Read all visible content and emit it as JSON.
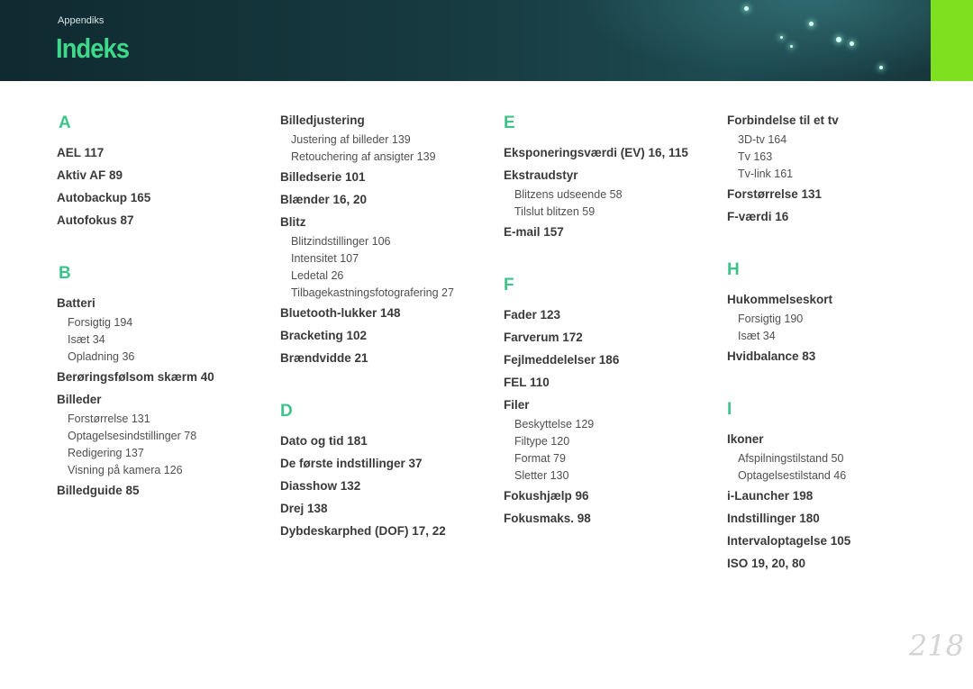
{
  "header": {
    "section": "Appendiks",
    "title": "Indeks"
  },
  "columns": [
    {
      "letter1": "A",
      "a": [
        "AEL  117",
        "Aktiv AF  89",
        "Autobackup  165",
        "Autofokus  87"
      ],
      "letter2": "B",
      "batteri": "Batteri",
      "batteri_sub": [
        "Forsigtig  194",
        "Isæt  34",
        "Opladning  36"
      ],
      "beroring": "Berøringsfølsom skærm  40",
      "billeder": "Billeder",
      "billeder_sub": [
        "Forstørrelse  131",
        "Optagelsesindstillinger  78",
        "Redigering  137",
        "Visning på kamera  126"
      ],
      "billedguide": "Billedguide  85"
    },
    {
      "billedjustering": "Billedjustering",
      "billedjustering_sub": [
        "Justering af billeder  139",
        "Retouchering af ansigter  139"
      ],
      "billedserie": "Billedserie  101",
      "blaender": "Blænder  16, 20",
      "blitz": "Blitz",
      "blitz_sub": [
        "Blitzindstillinger  106",
        "Intensitet  107",
        "Ledetal  26",
        "Tilbagekastningsfotografering  27"
      ],
      "more_b": [
        "Bluetooth-lukker  148",
        "Bracketing  102",
        "Brændvidde  21"
      ],
      "letter": "D",
      "d": [
        "Dato og tid  181",
        "De første indstillinger  37",
        "Diasshow  132",
        "Drej  138",
        "Dybdeskarphed (DOF)  17, 22"
      ]
    },
    {
      "letter1": "E",
      "eksponering": "Eksponeringsværdi (EV)  16, 115",
      "ekstraudstyr": "Ekstraudstyr",
      "ekstraudstyr_sub": [
        "Blitzens udseende  58",
        "Tilslut blitzen  59"
      ],
      "email": "E-mail  157",
      "letter2": "F",
      "f": [
        "Fader  123",
        "Farverum  172",
        "Fejlmeddelelser  186",
        "FEL  110"
      ],
      "filer": "Filer",
      "filer_sub": [
        "Beskyttelse  129",
        "Filtype  120",
        "Format  79",
        "Sletter  130"
      ],
      "f2": [
        "Fokushjælp  96",
        "Fokusmaks.  98"
      ]
    },
    {
      "forbindelse": "Forbindelse til et tv",
      "forbindelse_sub": [
        "3D-tv  164",
        "Tv  163",
        "Tv-link  161"
      ],
      "forstorrelse": "Forstørrelse  131",
      "fvaerdi": "F-værdi  16",
      "letter_h": "H",
      "hukommelseskort": "Hukommelseskort",
      "hukommelseskort_sub": [
        "Forsigtig  190",
        "Isæt  34"
      ],
      "hvidbalance": "Hvidbalance  83",
      "letter_i": "I",
      "ikoner": "Ikoner",
      "ikoner_sub": [
        "Afspilningstilstand  50",
        "Optagelsestilstand  46"
      ],
      "i": [
        "i-Launcher  198",
        "Indstillinger  180",
        "Intervaloptagelse  105",
        "ISO  19, 20, 80"
      ]
    }
  ],
  "page_number": "218"
}
